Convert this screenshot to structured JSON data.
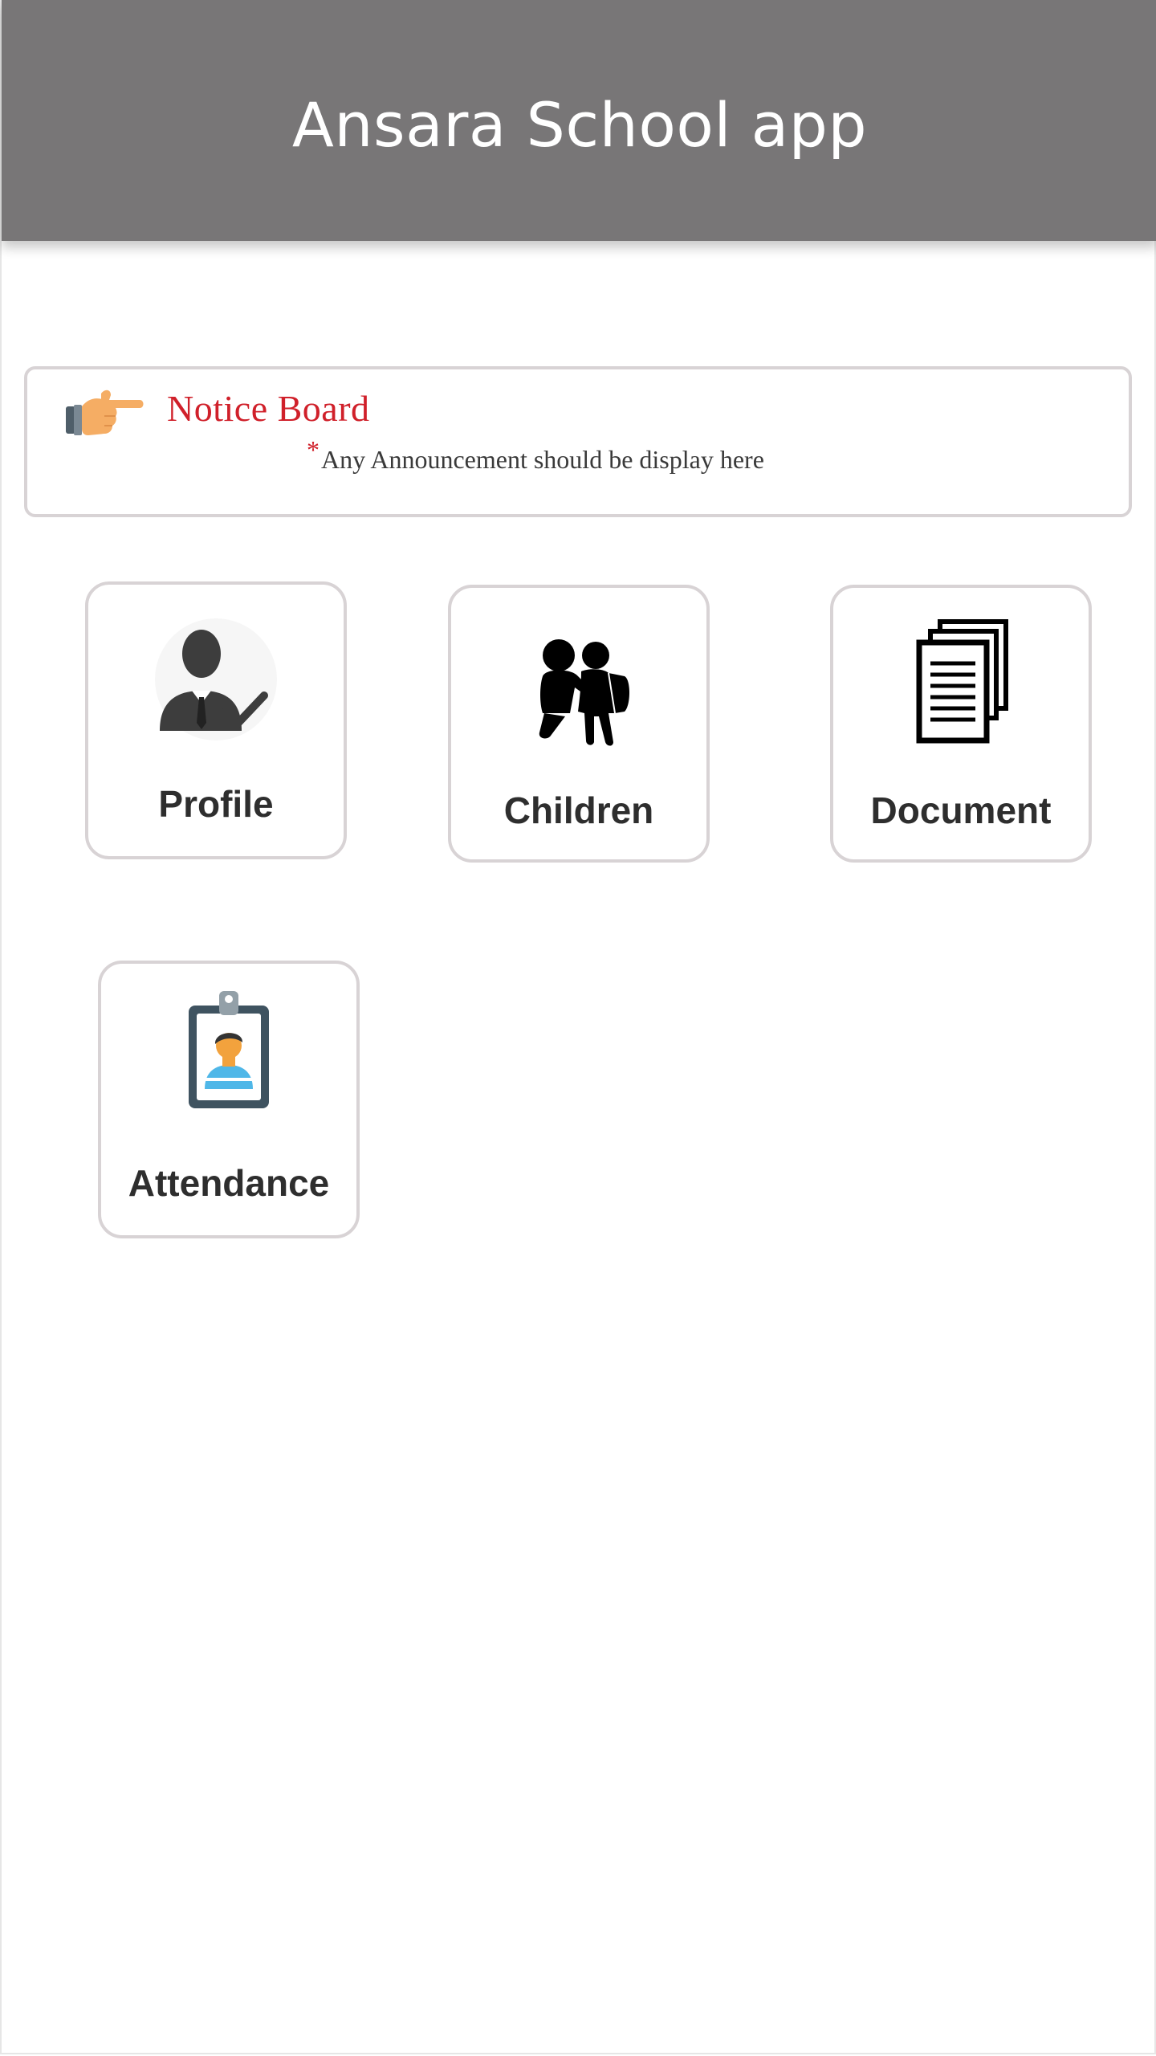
{
  "app": {
    "title": "Ansara School app"
  },
  "notice_board": {
    "title": "Notice Board",
    "asterisk": "*",
    "message": "Any Announcement should be display here",
    "icon": "pointing-hand-icon"
  },
  "tiles": [
    {
      "label": "Profile",
      "icon": "person-check-icon"
    },
    {
      "label": "Children",
      "icon": "parent-child-icon"
    },
    {
      "label": "Document",
      "icon": "documents-icon"
    },
    {
      "label": "Attendance",
      "icon": "id-badge-icon"
    }
  ],
  "colors": {
    "app_bar": "#787677",
    "notice_title": "#d0202a",
    "tile_border": "#d8d3d5"
  }
}
